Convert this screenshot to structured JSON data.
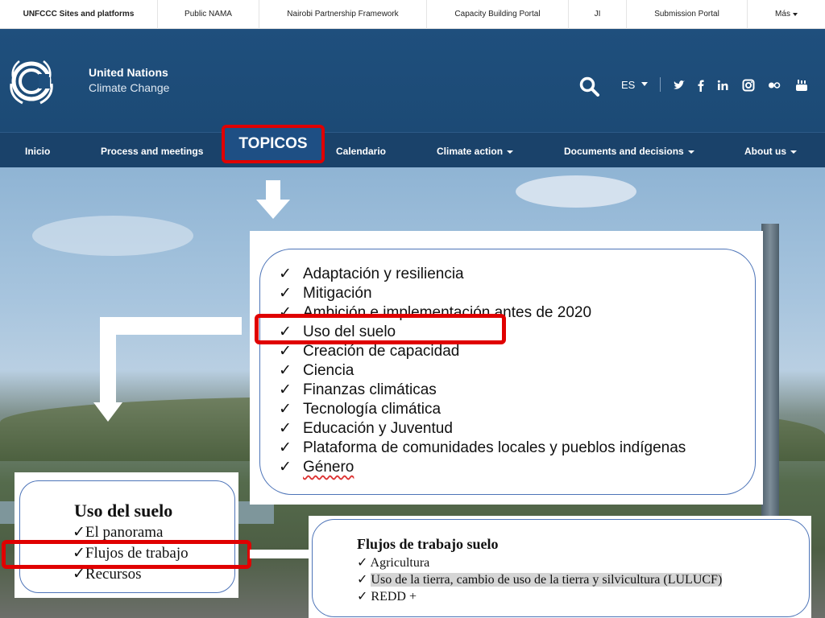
{
  "topbar": {
    "items": [
      "UNFCCC Sites and platforms",
      "Public NAMA",
      "Nairobi Partnership Framework",
      "Capacity Building Portal",
      "JI",
      "Submission Portal",
      "Más"
    ]
  },
  "header": {
    "brand_line1": "United Nations",
    "brand_line2": "Climate Change",
    "language": "ES",
    "social_icons": [
      "twitter-icon",
      "facebook-icon",
      "linkedin-icon",
      "instagram-icon",
      "flickr-icon",
      "youtube-icon"
    ]
  },
  "nav": {
    "items": [
      "Inicio",
      "Process and meetings",
      "TOPICOS",
      "Calendario",
      "Climate action",
      "Documents and decisions",
      "About us"
    ]
  },
  "topics": {
    "check": "✓",
    "items": [
      "Adaptación y resiliencia",
      "Mitigación",
      "Ambición e implementación antes de 2020",
      "Uso del suelo",
      "Creación de capacidad",
      "Ciencia",
      "Finanzas climáticas",
      "Tecnología climática",
      "Educación y Juventud",
      "Plataforma de comunidades locales y pueblos indígenas",
      "Género"
    ]
  },
  "uso_panel": {
    "title": "Uso del suelo",
    "items": [
      "El panorama",
      "Flujos de trabajo",
      "Recursos"
    ]
  },
  "flujos_panel": {
    "title": "Flujos de trabajo suelo",
    "items": [
      "Agricultura",
      "Uso de la tierra, cambio de uso de la tierra y silvicultura (LULUCF)",
      "REDD +"
    ]
  },
  "colors": {
    "header_blue": "#1f4f7d",
    "nav_blue": "#1a426a",
    "highlight_red": "#e00000",
    "panel_border": "#4d74b8"
  }
}
